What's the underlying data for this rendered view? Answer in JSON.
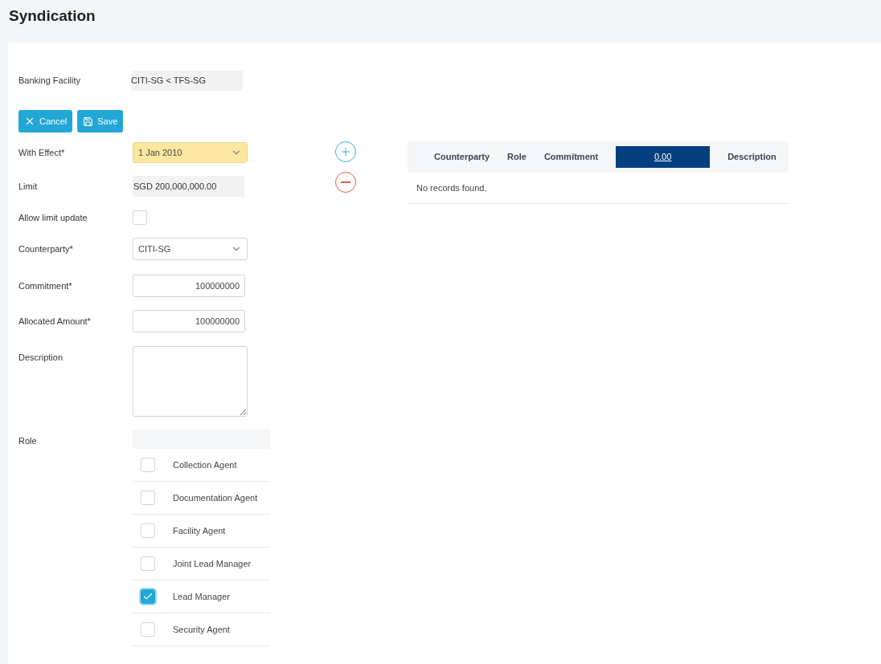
{
  "page": {
    "title": "Syndication"
  },
  "form": {
    "banking_facility": {
      "label": "Banking Facility",
      "value": "CITI-SG < TFS-SG"
    },
    "buttons": [
      {
        "kind": "cancel",
        "label": "Cancel"
      },
      {
        "kind": "save",
        "label": "Save"
      }
    ],
    "with_effect": {
      "label": "With Effect*",
      "value": "1 Jan 2010"
    },
    "limit": {
      "label": "Limit",
      "value": "SGD 200,000,000.00"
    },
    "allow_limit_update": {
      "label": "Allow limit update",
      "checked": false
    },
    "counterparty": {
      "label": "Counterparty*",
      "value": "CITI-SG"
    },
    "commitment": {
      "label": "Commitment*",
      "value": "100000000"
    },
    "allocated_amount": {
      "label": "Allocated Amount*",
      "value": "100000000"
    },
    "description": {
      "label": "Description"
    },
    "role": {
      "label": "Role",
      "options": [
        {
          "label": "Collection Agent",
          "checked": false
        },
        {
          "label": "Documentation Agent",
          "checked": false
        },
        {
          "label": "Facility Agent",
          "checked": false
        },
        {
          "label": "Joint Lead Manager",
          "checked": false
        },
        {
          "label": "Lead Manager",
          "checked": true
        },
        {
          "label": "Security Agent",
          "checked": false
        }
      ]
    }
  },
  "table": {
    "columns": [
      {
        "kind": "text",
        "label": "Counterparty"
      },
      {
        "kind": "text",
        "label": "Role"
      },
      {
        "kind": "text",
        "label": "Commitment"
      },
      {
        "kind": "total",
        "label": "0.00"
      },
      {
        "kind": "text",
        "label": "Description"
      }
    ],
    "empty_message": "No records found."
  }
}
